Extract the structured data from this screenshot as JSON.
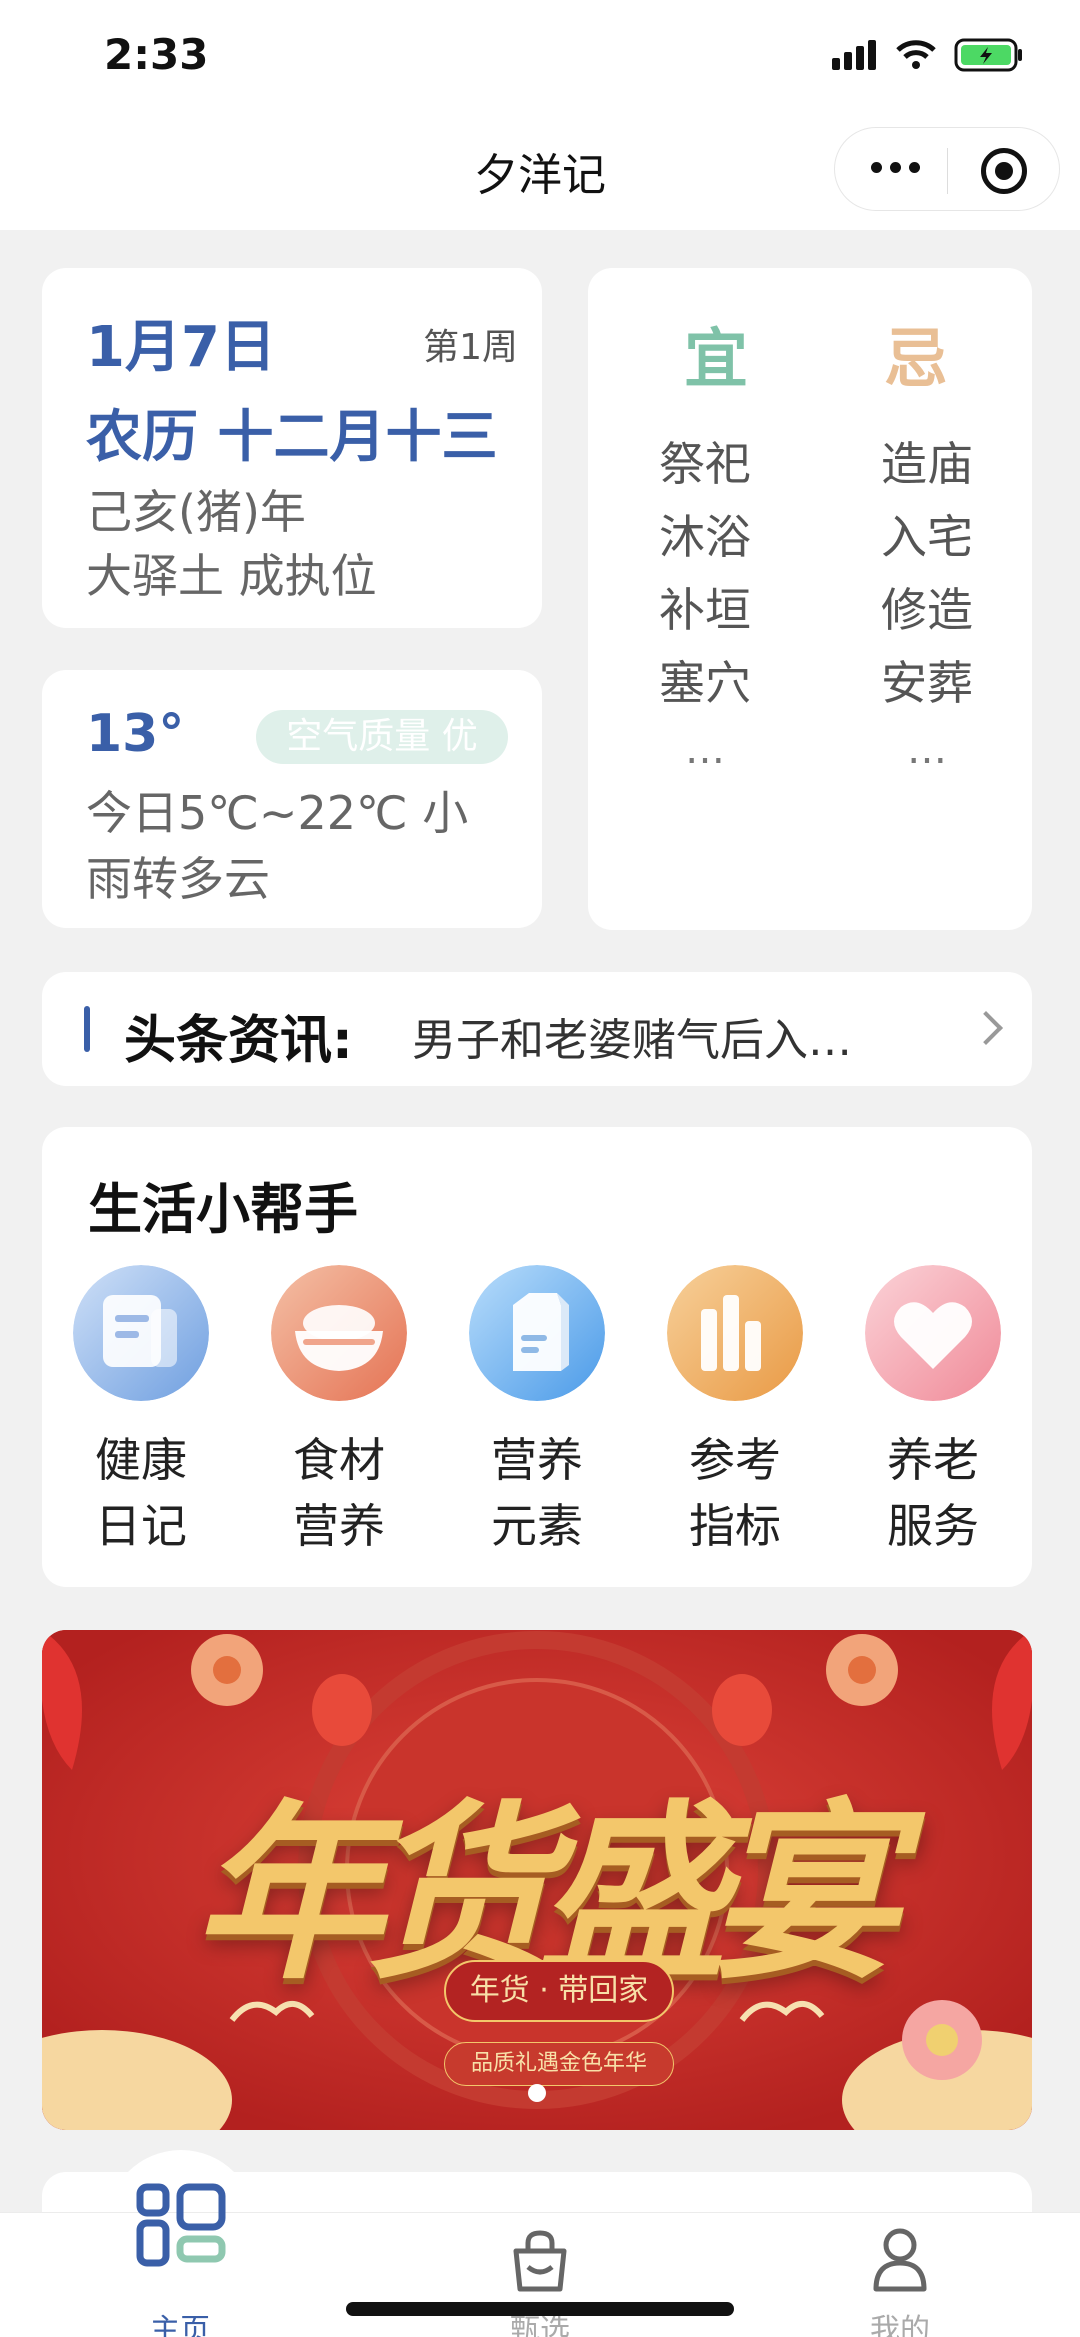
{
  "status": {
    "time": "2:33"
  },
  "navbar": {
    "title": "夕洋记"
  },
  "date": {
    "solar": "1月7日",
    "week": "第1周",
    "lunar": "农历 十二月十三",
    "ganzhi": "己亥(猪)年",
    "xiu": "大驿土 成执位"
  },
  "weather": {
    "temp": "13°",
    "air_quality": "空气质量 优",
    "desc": "今日5℃~22℃ 小雨转多云"
  },
  "almanac": {
    "yi_label": "宜",
    "ji_label": "忌",
    "yi": [
      "祭祀",
      "沐浴",
      "补垣",
      "塞穴"
    ],
    "ji": [
      "造庙",
      "入宅",
      "修造",
      "安葬"
    ],
    "more": "…"
  },
  "news": {
    "label": "头条资讯:",
    "headline": "男子和老婆赌气后入…"
  },
  "helper": {
    "title": "生活小帮手",
    "items": [
      {
        "line1": "健康",
        "line2": "日记",
        "icon": "diary-icon"
      },
      {
        "line1": "食材",
        "line2": "营养",
        "icon": "bowl-icon"
      },
      {
        "line1": "营养",
        "line2": "元素",
        "icon": "milk-icon"
      },
      {
        "line1": "参考",
        "line2": "指标",
        "icon": "bars-icon"
      },
      {
        "line1": "养老",
        "line2": "服务",
        "icon": "heart-icon"
      }
    ]
  },
  "banner": {
    "title": "年货盛宴",
    "pill": "年货 · 带回家",
    "sub": "品质礼遇金色年华"
  },
  "tabs": [
    {
      "label": "主页",
      "icon": "home-grid-icon"
    },
    {
      "label": "甄选",
      "icon": "shopping-bag-icon"
    },
    {
      "label": "我的",
      "icon": "user-icon"
    }
  ],
  "colors": {
    "accent": "#3a5fa8",
    "yi": "#7fc2a8",
    "ji": "#e9bf95",
    "banner_red": "#c9302c"
  }
}
